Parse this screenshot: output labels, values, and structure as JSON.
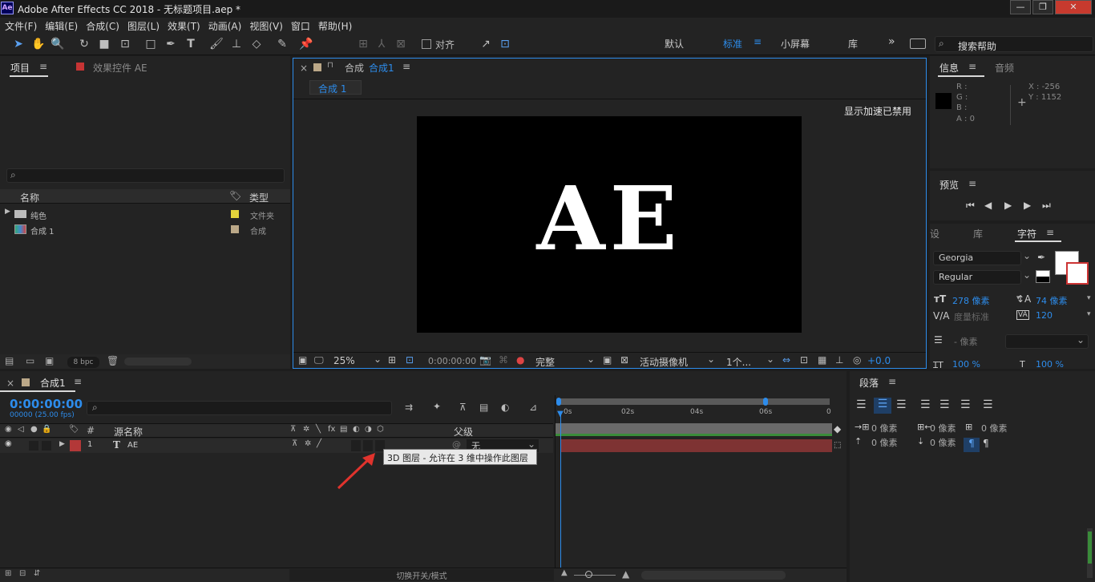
{
  "window": {
    "title": "Adobe After Effects CC 2018 - 无标题项目.aep *",
    "logo": "Ae",
    "min": "—",
    "max": "❐",
    "close": "✕"
  },
  "menu": [
    "文件(F)",
    "编辑(E)",
    "合成(C)",
    "图层(L)",
    "效果(T)",
    "动画(A)",
    "视图(V)",
    "窗口",
    "帮助(H)"
  ],
  "toolbar": {
    "align_label": "对齐",
    "workspaces": [
      "默认",
      "标准",
      "小屏幕",
      "库"
    ],
    "active_workspace": "标准",
    "more": "»",
    "search_placeholder": "搜索帮助"
  },
  "project": {
    "tab": "项目",
    "menu": "≡",
    "effects_tab": "效果控件 AE",
    "col_name": "名称",
    "col_type": "类型",
    "items": [
      {
        "name": "纯色",
        "type": "文件夹",
        "color": "#e3d33b"
      },
      {
        "name": "合成 1",
        "type": "合成",
        "color": "#bba888"
      }
    ],
    "bpc": "8 bpc"
  },
  "comp": {
    "close": "×",
    "lock": "🔓",
    "tab_prefix": "合成",
    "tab_name": "合成1",
    "breadcrumb": "合成 1",
    "accel": "显示加速已禁用",
    "text": "AE",
    "zoom": "25%",
    "timecode": "0:00:00:00",
    "resolution": "完整",
    "camera": "活动摄像机",
    "views": "1个...",
    "exposure": "+0.0"
  },
  "info": {
    "tab": "信息",
    "audio_tab": "音频",
    "R": "R :",
    "G": "G :",
    "B": "B :",
    "A": "A : 0",
    "X": "X : -256",
    "Y": "Y : 1152"
  },
  "preview": {
    "tab": "预览"
  },
  "character": {
    "tab_left": "设",
    "tab_lib": "库",
    "tab": "字符",
    "font": "Georgia",
    "style": "Regular",
    "size": "278 像素",
    "leading": "74 像素",
    "kerning": "度量标准",
    "tracking": "120",
    "stroke": "- 像素",
    "vscale": "100 %",
    "hscale": "100 %"
  },
  "paragraph": {
    "tab": "段落",
    "indent_left": "0 像素",
    "indent_right": "0 像素",
    "indent_first": "0 像素",
    "space_before": "0 像素",
    "space_after": "0 像素"
  },
  "timeline": {
    "tab": "合成1",
    "timecode": "0:00:00:00",
    "fps": "00000 (25.00 fps)",
    "col_src": "源名称",
    "col_parent": "父级",
    "layer_num": "1",
    "layer_type": "T",
    "layer_name": "AE",
    "parent": "无",
    "tooltip": "3D 图层 - 允许在 3 维中操作此图层",
    "ruler": [
      "0s",
      "02s",
      "04s",
      "06s"
    ],
    "bottom_label": "切换开关/模式"
  },
  "colors": {
    "accent": "#2d8ceb",
    "layer": "#b33838",
    "bar": "#7e3333",
    "green": "#3a8c3a"
  }
}
